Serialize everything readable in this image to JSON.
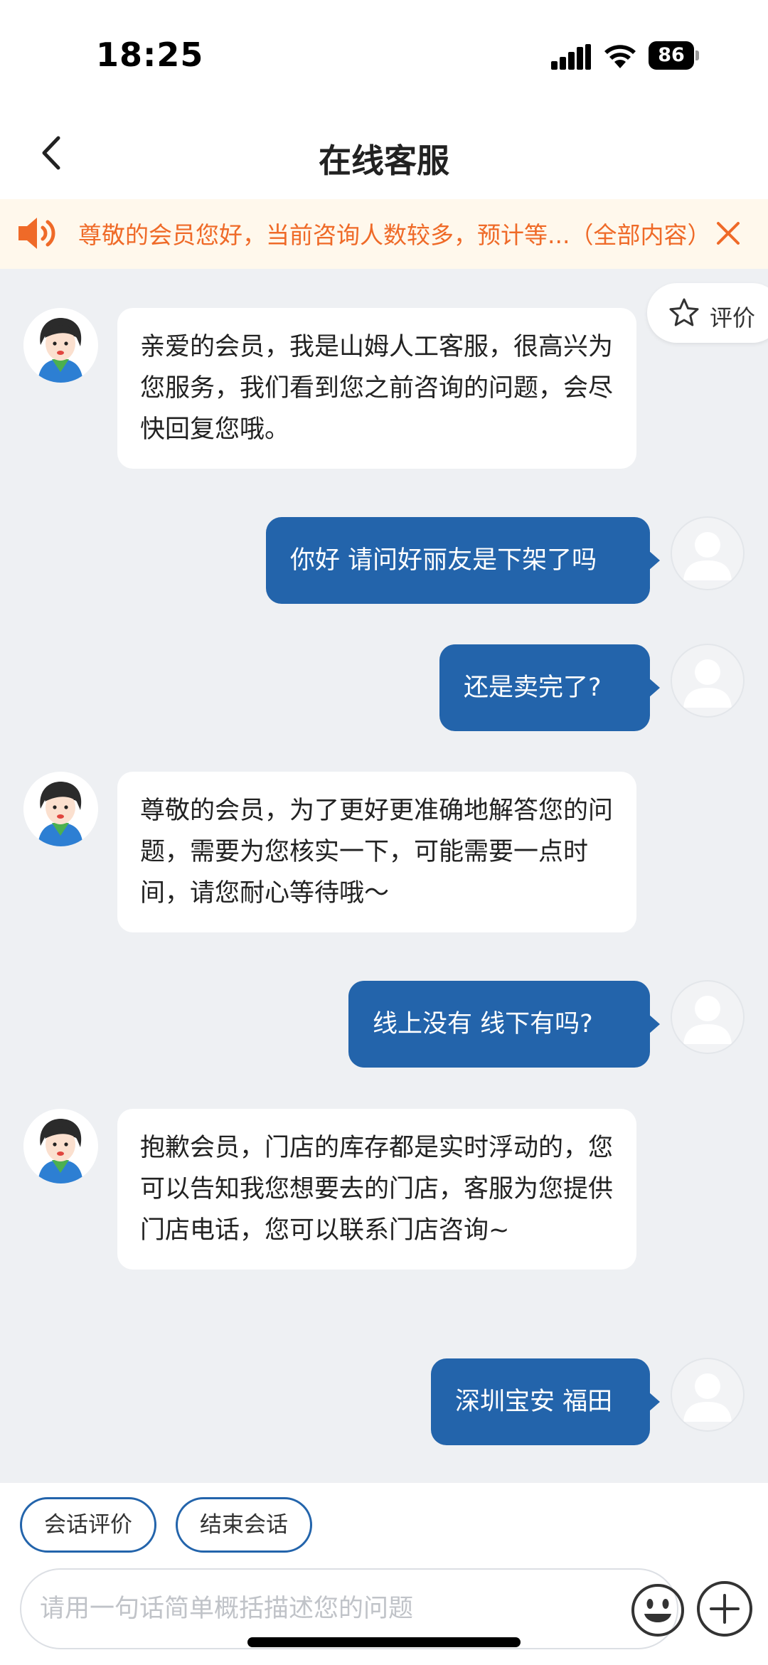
{
  "status_bar": {
    "time": "18:25",
    "battery": "86"
  },
  "header": {
    "title": "在线客服"
  },
  "notice": {
    "text": "尊敬的会员您好，当前咨询人数较多，预计等...（全部内容）"
  },
  "rate": {
    "label": "评价"
  },
  "messages": [
    {
      "sender": "agent",
      "text": "亲爱的会员，我是山姆人工客服，很高兴为您服务，我们看到您之前咨询的问题，会尽快回复您哦。"
    },
    {
      "sender": "user",
      "text": "你好 请问好丽友是下架了吗"
    },
    {
      "sender": "user",
      "text": "还是卖完了?"
    },
    {
      "sender": "agent",
      "text": "尊敬的会员，为了更好更准确地解答您的问题，需要为您核实一下，可能需要一点时间，请您耐心等待哦～"
    },
    {
      "sender": "user",
      "text": "线上没有 线下有吗?"
    },
    {
      "sender": "agent",
      "text": "抱歉会员，门店的库存都是实时浮动的，您可以告知我您想要去的门店，客服为您提供门店电话，您可以联系门店咨询~"
    },
    {
      "sender": "user",
      "text": "深圳宝安 福田"
    }
  ],
  "bottom": {
    "chip_rate": "会话评价",
    "chip_end": "结束会话",
    "input_placeholder": "请用一句话简单概括描述您的问题"
  },
  "colors": {
    "accent": "#2364ab",
    "notice_text": "#ef6a28",
    "notice_bg": "#fff8ec",
    "chat_bg": "#eef0f3"
  }
}
